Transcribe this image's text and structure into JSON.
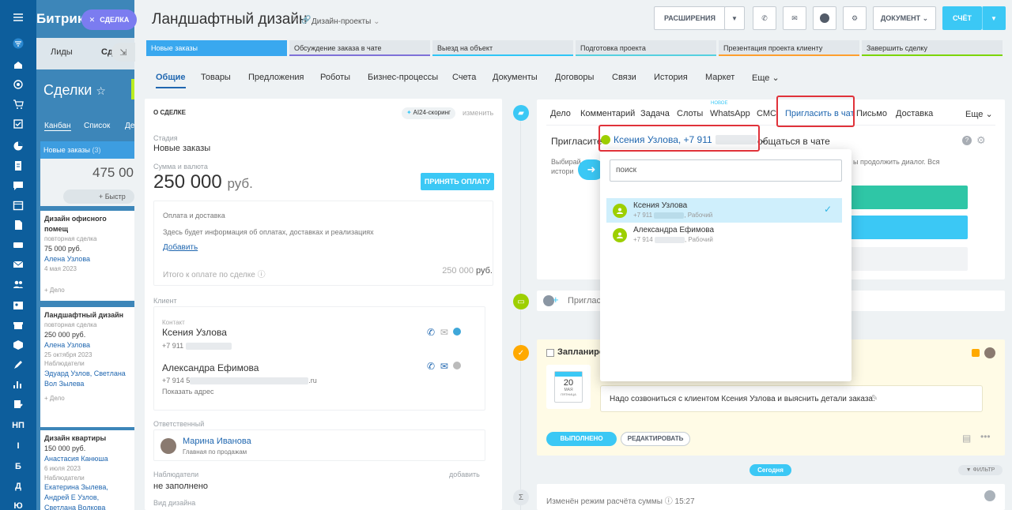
{
  "background": {
    "brand": "Битрик",
    "tabs": [
      "Лиды",
      "Сд"
    ],
    "title": "Сделки",
    "view_tabs": [
      "Канбан",
      "Список",
      "Де"
    ],
    "column": {
      "name": "Новые заказы",
      "count": "(3)",
      "sum": "475 00",
      "quick_add": "+ Быстр"
    },
    "cards": [
      {
        "title": "Дизайн офисного помещ",
        "type": "повторная сделка",
        "price": "75 000 руб.",
        "contact": "Алена Узлова",
        "date": "4 мая 2023",
        "add": "+ Дело"
      },
      {
        "title": "Ландшафтный дизайн",
        "type": "повторная сделка",
        "price": "250 000 руб.",
        "contact": "Алена Узлова",
        "date": "25 октября 2023",
        "observers_label": "Наблюдатели",
        "observers": "Эдуард Узлов, Светлана Вол Зылева",
        "add": "+ Дело"
      },
      {
        "title": "Дизайн квартиры",
        "price": "150 000 руб.",
        "contact": "Анастасия Канюша",
        "date": "6 июля 2023",
        "observers_label": "Наблюдатели",
        "observers": "Екатерина Зылева, Андрей Е Узлов, Светлана Волкова"
      }
    ],
    "rail_letters": [
      "НП",
      "I",
      "Б",
      "Д",
      "Ю"
    ]
  },
  "slider_tag": "СДЕЛКА",
  "header": {
    "title": "Ландшафтный дизайн",
    "category": "Дизайн-проекты",
    "extensions": "РАСШИРЕНИЯ",
    "document": "ДОКУМЕНТ",
    "invoice": "СЧЁТ"
  },
  "stages": [
    {
      "label": "Новые заказы",
      "color": "#39a8ef"
    },
    {
      "label": "Обсуждение заказа в чате",
      "color": "#7e71d8"
    },
    {
      "label": "Выезд на объект",
      "color": "#2fc6f6"
    },
    {
      "label": "Подготовка проекта",
      "color": "#55d0e0"
    },
    {
      "label": "Презентация проекта клиенту",
      "color": "#ff9f2e"
    },
    {
      "label": "Завершить сделку",
      "color": "#7bd500"
    }
  ],
  "tabs": [
    "Общие",
    "Товары",
    "Предложения",
    "Роботы",
    "Бизнес-процессы",
    "Счета",
    "Документы",
    "Договоры",
    "Связи",
    "История",
    "Маркет",
    "Еще"
  ],
  "about": {
    "heading": "О СДЕЛКЕ",
    "scoring": "AI24-скоринг",
    "change": "изменить",
    "stage_label": "Стадия",
    "stage": "Новые заказы",
    "sum_label": "Сумма и валюта",
    "sum": "250 000",
    "currency": "руб.",
    "accept_payment": "ПРИНЯТЬ ОПЛАТУ",
    "payment_title": "Оплата и доставка",
    "payment_text": "Здесь будет информация об оплатах, доставках и реализациях",
    "add": "Добавить",
    "total_label": "Итого к оплате по сделке",
    "total": "250 000",
    "total_currency": "руб.",
    "client_label": "Клиент",
    "contact_label": "Контакт",
    "contact1": {
      "name": "Ксения Узлова",
      "phone": "+7 911"
    },
    "contact2": {
      "name": "Александра Ефимова",
      "phone": "+7 914 5",
      "email_tail": ".ru"
    },
    "show_address": "Показать адрес",
    "responsible_label": "Ответственный",
    "responsible": {
      "name": "Марина Иванова",
      "position": "Главная по продажам"
    },
    "observers_label": "Наблюдатели",
    "observers_add": "добавить",
    "observers": "не заполнено",
    "design_type_label": "Вид дизайна"
  },
  "activity": {
    "tabs": [
      "Дело",
      "Комментарий",
      "Задача",
      "Слоты",
      "WhatsApp",
      "СМС",
      "Пригласить в чат",
      "Письмо",
      "Доставка",
      "Еще"
    ],
    "new_badge": "НОВОЕ",
    "invite_prefix": "Пригласите",
    "invite_contact": "Ксения Узлова, +7 911",
    "invite_suffix": "общаться в чате",
    "hint_left": "Выбирай",
    "hint_left2": "истори",
    "hint_right": "ы продолжить диалог. Вся"
  },
  "dropdown": {
    "search_placeholder": "поиск",
    "items": [
      {
        "name": "Ксения Узлова",
        "phone": "+7 911",
        "phone_type": ", Рабочий",
        "selected": true
      },
      {
        "name": "Александра Ефимова",
        "phone": "+7 914",
        "phone_type": ", Рабочий",
        "selected": false
      }
    ]
  },
  "timeline": {
    "comment_placeholder": "Пригласи",
    "planned_label": "Запланиров",
    "calendar_day": "20",
    "calendar_month": "МАЯ",
    "calendar_weekday": "ПЯТНИЦА",
    "task_text": "Надо созвониться с клиентом Ксения Узлова и выяснить детали заказа.",
    "done": "ВЫПОЛНЕНО",
    "edit": "РЕДАКТИРОВАТЬ",
    "today": "Сегодня",
    "filter": "ФИЛЬТР",
    "event_text": "Изменён режим расчёта суммы",
    "event_time": "15:27"
  }
}
